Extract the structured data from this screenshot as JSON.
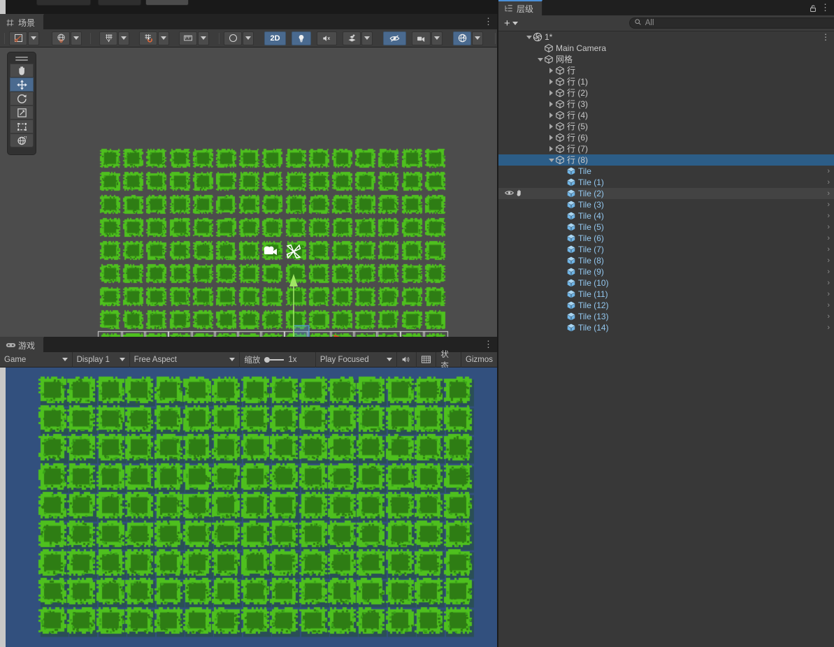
{
  "app": {
    "theme_bg": "#383838",
    "accent": "#4a90d9",
    "selection": "#2c5d87"
  },
  "scene_panel": {
    "tab_label": "场景",
    "tab_icon": "grid-icon",
    "toolbar": {
      "tools": [
        {
          "name": "draw-mode-dropdown",
          "icon": "pivot-rotation-icon",
          "active": false,
          "has_caret": true
        },
        {
          "name": "global-local-dropdown",
          "icon": "globe-icon",
          "active": false,
          "has_caret": true
        },
        {
          "name": "grid-visibility-dropdown",
          "icon": "grid-axis-icon",
          "active": false,
          "has_caret": true
        },
        {
          "name": "grid-snap-dropdown",
          "icon": "grid-magnet-icon",
          "active": false,
          "has_caret": true
        },
        {
          "name": "ruler-dropdown",
          "icon": "ruler-icon",
          "active": false,
          "has_caret": true
        }
      ],
      "right_tools": [
        {
          "name": "shading-mode-dropdown",
          "icon": "sphere-icon",
          "label": "",
          "active": false,
          "has_caret": true
        },
        {
          "name": "2d-toggle",
          "icon": "",
          "label": "2D",
          "active": true,
          "has_caret": false
        },
        {
          "name": "scene-lighting-toggle",
          "icon": "bulb-icon",
          "label": "",
          "active": true,
          "has_caret": false
        },
        {
          "name": "audio-toggle",
          "icon": "audio-mute-icon",
          "label": "",
          "active": false,
          "has_caret": false
        },
        {
          "name": "effects-dropdown",
          "icon": "fx-icon",
          "label": "",
          "active": false,
          "has_caret": true
        },
        {
          "name": "hidden-objects-toggle",
          "icon": "eye-slash-icon",
          "label": "",
          "active": true,
          "has_caret": false
        },
        {
          "name": "scene-camera-dropdown",
          "icon": "camera-icon",
          "label": "",
          "active": false,
          "has_caret": true
        },
        {
          "name": "gizmos-toggle",
          "icon": "gizmos-globe-icon",
          "label": "",
          "active": true,
          "has_caret": true
        }
      ]
    },
    "tool_palette": [
      {
        "name": "hand-tool",
        "icon": "hand-icon",
        "active": false
      },
      {
        "name": "move-tool",
        "icon": "move-icon",
        "active": true
      },
      {
        "name": "rotate-tool",
        "icon": "rotate-icon",
        "active": false
      },
      {
        "name": "scale-tool",
        "icon": "scale-icon",
        "active": false
      },
      {
        "name": "rect-tool",
        "icon": "rect-icon",
        "active": false
      },
      {
        "name": "transform-tool",
        "icon": "transform-icon",
        "active": false
      }
    ],
    "viewport": {
      "background": "#4c4c4c",
      "camera_frame": true,
      "grid_cols": 15,
      "grid_rows": 9,
      "camera_gizmo": "camera-icon",
      "light_gizmo": "light-gizmo-icon",
      "move_gizmo": {
        "x_axis_color": "#ef4223",
        "y_axis_color": "#a0e664",
        "plane_color": "#4f9ad7"
      },
      "selected_row_index": 8
    }
  },
  "game_panel": {
    "tab_label": "游戏",
    "tab_icon": "gamepad-icon",
    "toolbar": {
      "view_select": "Game",
      "display_select": "Display 1",
      "aspect_select": "Free Aspect",
      "scale_label": "缩放",
      "scale_value": "1x",
      "play_mode": "Play Focused",
      "mute_audio_icon": "speaker-icon",
      "stats_icon": "stats-grid-icon",
      "stats_label": "状态",
      "gizmos_label": "Gizmos"
    },
    "viewport": {
      "background": "#32507e",
      "grid_cols": 15,
      "grid_rows": 9
    }
  },
  "hierarchy_panel": {
    "tab_label": "层级",
    "tab_icon": "hierarchy-icon",
    "lock_icon": "lock-open-icon",
    "menu_icon": "kebab-menu-icon",
    "create_label": "+",
    "search_placeholder": "All",
    "search_icon": "search-icon",
    "expand_icon": "expand-panel-icon",
    "tree": [
      {
        "name": "scene-root",
        "label": "1*",
        "depth": 0,
        "twirl": "open",
        "icon": "scene-icon",
        "selected": false,
        "kind": "scene",
        "menu": true
      },
      {
        "name": "main-camera",
        "label": "Main Camera",
        "depth": 1,
        "twirl": "none",
        "icon": "gameobject-icon",
        "selected": false,
        "kind": "object"
      },
      {
        "name": "grid-root",
        "label": "网格",
        "depth": 1,
        "twirl": "open",
        "icon": "gameobject-icon",
        "selected": false,
        "kind": "object"
      },
      {
        "name": "row-0",
        "label": "行",
        "depth": 2,
        "twirl": "closed",
        "icon": "gameobject-icon",
        "selected": false,
        "kind": "object"
      },
      {
        "name": "row-1",
        "label": "行 (1)",
        "depth": 2,
        "twirl": "closed",
        "icon": "gameobject-icon",
        "selected": false,
        "kind": "object"
      },
      {
        "name": "row-2",
        "label": "行 (2)",
        "depth": 2,
        "twirl": "closed",
        "icon": "gameobject-icon",
        "selected": false,
        "kind": "object"
      },
      {
        "name": "row-3",
        "label": "行 (3)",
        "depth": 2,
        "twirl": "closed",
        "icon": "gameobject-icon",
        "selected": false,
        "kind": "object"
      },
      {
        "name": "row-4",
        "label": "行 (4)",
        "depth": 2,
        "twirl": "closed",
        "icon": "gameobject-icon",
        "selected": false,
        "kind": "object"
      },
      {
        "name": "row-5",
        "label": "行 (5)",
        "depth": 2,
        "twirl": "closed",
        "icon": "gameobject-icon",
        "selected": false,
        "kind": "object"
      },
      {
        "name": "row-6",
        "label": "行 (6)",
        "depth": 2,
        "twirl": "closed",
        "icon": "gameobject-icon",
        "selected": false,
        "kind": "object"
      },
      {
        "name": "row-7",
        "label": "行 (7)",
        "depth": 2,
        "twirl": "closed",
        "icon": "gameobject-icon",
        "selected": false,
        "kind": "object"
      },
      {
        "name": "row-8",
        "label": "行 (8)",
        "depth": 2,
        "twirl": "open",
        "icon": "gameobject-icon",
        "selected": true,
        "kind": "object"
      },
      {
        "name": "tile-0",
        "label": "Tile",
        "depth": 3,
        "twirl": "none",
        "icon": "prefab-icon",
        "selected": false,
        "kind": "tile",
        "chevron": true
      },
      {
        "name": "tile-1",
        "label": "Tile (1)",
        "depth": 3,
        "twirl": "none",
        "icon": "prefab-icon",
        "selected": false,
        "kind": "tile",
        "chevron": true
      },
      {
        "name": "tile-2",
        "label": "Tile (2)",
        "depth": 3,
        "twirl": "none",
        "icon": "prefab-icon",
        "selected": false,
        "kind": "tile",
        "chevron": true,
        "hovered": true,
        "visibility_toggle": "eye-icon",
        "pickable_toggle": "hand-icon"
      },
      {
        "name": "tile-3",
        "label": "Tile (3)",
        "depth": 3,
        "twirl": "none",
        "icon": "prefab-icon",
        "selected": false,
        "kind": "tile",
        "chevron": true
      },
      {
        "name": "tile-4",
        "label": "Tile (4)",
        "depth": 3,
        "twirl": "none",
        "icon": "prefab-icon",
        "selected": false,
        "kind": "tile",
        "chevron": true
      },
      {
        "name": "tile-5",
        "label": "Tile (5)",
        "depth": 3,
        "twirl": "none",
        "icon": "prefab-icon",
        "selected": false,
        "kind": "tile",
        "chevron": true
      },
      {
        "name": "tile-6",
        "label": "Tile (6)",
        "depth": 3,
        "twirl": "none",
        "icon": "prefab-icon",
        "selected": false,
        "kind": "tile",
        "chevron": true
      },
      {
        "name": "tile-7",
        "label": "Tile (7)",
        "depth": 3,
        "twirl": "none",
        "icon": "prefab-icon",
        "selected": false,
        "kind": "tile",
        "chevron": true
      },
      {
        "name": "tile-8",
        "label": "Tile (8)",
        "depth": 3,
        "twirl": "none",
        "icon": "prefab-icon",
        "selected": false,
        "kind": "tile",
        "chevron": true
      },
      {
        "name": "tile-9",
        "label": "Tile (9)",
        "depth": 3,
        "twirl": "none",
        "icon": "prefab-icon",
        "selected": false,
        "kind": "tile",
        "chevron": true
      },
      {
        "name": "tile-10",
        "label": "Tile (10)",
        "depth": 3,
        "twirl": "none",
        "icon": "prefab-icon",
        "selected": false,
        "kind": "tile",
        "chevron": true
      },
      {
        "name": "tile-11",
        "label": "Tile (11)",
        "depth": 3,
        "twirl": "none",
        "icon": "prefab-icon",
        "selected": false,
        "kind": "tile",
        "chevron": true
      },
      {
        "name": "tile-12",
        "label": "Tile (12)",
        "depth": 3,
        "twirl": "none",
        "icon": "prefab-icon",
        "selected": false,
        "kind": "tile",
        "chevron": true
      },
      {
        "name": "tile-13",
        "label": "Tile (13)",
        "depth": 3,
        "twirl": "none",
        "icon": "prefab-icon",
        "selected": false,
        "kind": "tile",
        "chevron": true
      },
      {
        "name": "tile-14",
        "label": "Tile (14)",
        "depth": 3,
        "twirl": "none",
        "icon": "prefab-icon",
        "selected": false,
        "kind": "tile",
        "chevron": true
      }
    ]
  },
  "tile_art": {
    "edge_color": "#4ec01e",
    "mid_color": "#3aa519",
    "core_color": "#2e7d14",
    "shadow_color": "#1d4d0c"
  }
}
